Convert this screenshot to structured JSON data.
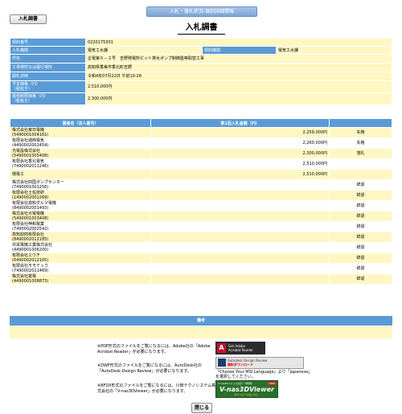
{
  "header": {
    "tab_label": "入札・落札状況-個別詳細情報",
    "back_button": "入札調書",
    "title": "入札調書"
  },
  "info": {
    "contract_no_label": "契約番号",
    "contract_no": "0220175301",
    "org_label": "入札機関",
    "org": "電気工水課",
    "contract_org_label": "契約機関",
    "contract_org": "電気工水課",
    "item_label": "件名",
    "item": "企電第６－２号　吉野発電所ピット排水ポンプ制御盤等取替工事",
    "place_label": "工事場所又は履行場所",
    "place": "高知県香美市香北町吉野",
    "date_label": "開札日時",
    "date": "令和4年07月22日 午前10:28",
    "estimate_label": "予定価格（円）\n（税抜き）",
    "estimate": "2,510,000円",
    "min_label": "最低制限価格（円）\n（税抜き）",
    "min": "2,300,000円"
  },
  "bids": {
    "headers": [
      "業者名（法人番号）",
      "第1回入札金額（円）",
      ""
    ],
    "rows": [
      {
        "name": "株式会社東日電機",
        "no": "(5490001004161)",
        "amount": "2,259,000円",
        "result": "失格"
      },
      {
        "name": "有限会社城西電気",
        "no": "(4490002002454)",
        "amount": "2,260,000円",
        "result": "失格"
      },
      {
        "name": "光電設株式会社",
        "no": "(5490001005408)",
        "amount": "2,300,000円",
        "result": "落札"
      },
      {
        "name": "有限会社香北電気",
        "no": "(7490002011246)",
        "amount": "2,510,000円",
        "result": ""
      },
      {
        "name": "環電工",
        "no": "",
        "amount": "2,510,000円",
        "result": ""
      },
      {
        "name": "株式会社四国ポンプセンター",
        "no": "(7490001001256)",
        "amount": "",
        "result": "辞退"
      },
      {
        "name": "有限会社土佐技研",
        "no": "(1490002001269)",
        "amount": "",
        "result": "辞退"
      },
      {
        "name": "有限会社高知ダルマ電機",
        "no": "(8490002001493)",
        "amount": "",
        "result": "辞退"
      },
      {
        "name": "株式会社大電電機",
        "no": "(5490001003408)",
        "amount": "",
        "result": "辞退"
      },
      {
        "name": "有限会社伸和電業",
        "no": "(7490002002542)",
        "amount": "",
        "result": "辞退"
      },
      {
        "name": "高知創商有限会社",
        "no": "(8490002012185)",
        "amount": "",
        "result": "辞退"
      },
      {
        "name": "共栄電機工業株式会社",
        "no": "(4490001006200)",
        "amount": "",
        "result": "辞退"
      },
      {
        "name": "有限会社エウチ",
        "no": "(6490002012105)",
        "amount": "",
        "result": "辞退"
      },
      {
        "name": "有限会社モモテック",
        "no": "(7490002011469)",
        "amount": "",
        "result": "辞退"
      },
      {
        "name": "株式会社富電",
        "no": "(4490001008873)",
        "amount": "",
        "result": "辞退"
      }
    ]
  },
  "remarks": {
    "label": "備考",
    "value": ""
  },
  "notes": {
    "pdf": "※PDF形式のファイルをご覧になるには、Adobe社の「Adobe Acrobat Reader」が必要になります。",
    "dwf": "※DWF形式のファイルをご覧になるには、AutoDesk社の「AutoDesk Design Review」が必要になります。",
    "sfx": "※BFOX形式のファイルをご覧になるには、川田テクノシステム株式会社の「V-nas3DViewer」が必要になります。",
    "msi": "「Choose Your MSI Language」より「Japanese」を選択してください。"
  },
  "downloads": {
    "adobe_top": "Get Adobe",
    "adobe_bottom": "Acrobat Reader",
    "autodesk_top": "Autodesk Design Review",
    "autodesk_bottom": "無料ダウンロード",
    "v3d_small": "V-nas3Dファイル表示・印刷用",
    "v3d_name": "V-nas3DViewer",
    "v3d_free": "FREE",
    "v3d_dl": "ダウンロードはこちら"
  },
  "footer": {
    "close_button": "閉じる"
  }
}
